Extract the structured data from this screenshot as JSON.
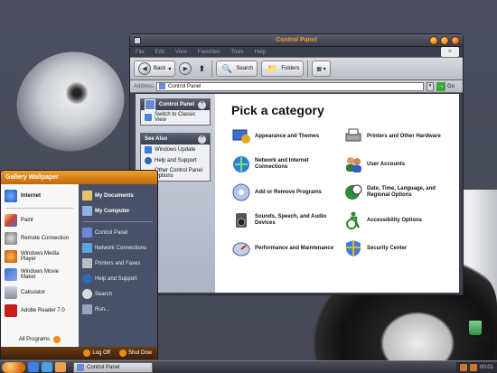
{
  "window": {
    "title": "Control Panel",
    "menu": [
      "File",
      "Edit",
      "View",
      "Favorites",
      "Tools",
      "Help"
    ],
    "toolbar": {
      "back": "Back",
      "search": "Search",
      "folders": "Folders"
    },
    "address": {
      "label": "Address",
      "value": "Control Panel",
      "go": "Go"
    }
  },
  "side": {
    "cp_header": "Control Panel",
    "switch_view": "Switch to Classic View",
    "see_also_header": "See Also",
    "see_also": [
      "Windows Update",
      "Help and Support",
      "Other Control Panel Options"
    ]
  },
  "main": {
    "heading": "Pick a category",
    "categories": [
      {
        "label": "Appearance and Themes",
        "icon": "appearance-icon"
      },
      {
        "label": "Printers and Other Hardware",
        "icon": "printer-icon"
      },
      {
        "label": "Network and Internet Connections",
        "icon": "network-icon"
      },
      {
        "label": "User Accounts",
        "icon": "users-icon"
      },
      {
        "label": "Add or Remove Programs",
        "icon": "add-remove-icon"
      },
      {
        "label": "Date, Time, Language, and Regional Options",
        "icon": "globe-clock-icon"
      },
      {
        "label": "Sounds, Speech, and Audio Devices",
        "icon": "speaker-icon"
      },
      {
        "label": "Accessibility Options",
        "icon": "accessibility-icon"
      },
      {
        "label": "Performance and Maintenance",
        "icon": "performance-icon"
      },
      {
        "label": "Security Center",
        "icon": "shield-icon"
      }
    ]
  },
  "start_menu": {
    "user": "Gallery Wallpaper",
    "left_items": [
      "Internet",
      "Paint",
      "Remote Connection",
      "Windows Media Player",
      "Windows Movie Maker",
      "Calculator",
      "Adobe Reader 7.0"
    ],
    "all_programs": "All Programs",
    "right_items": [
      "My Documents",
      "My Computer",
      "Control Panel",
      "Network Connections",
      "Printers and Faxes",
      "Help and Support",
      "Search",
      "Run..."
    ],
    "log_off": "Log Off",
    "shut_down": "Shut Dow"
  },
  "desktop": {
    "recycle_bin": "Recycle Bin"
  },
  "taskbar": {
    "task": "Control Panel",
    "clock": "00:01"
  }
}
